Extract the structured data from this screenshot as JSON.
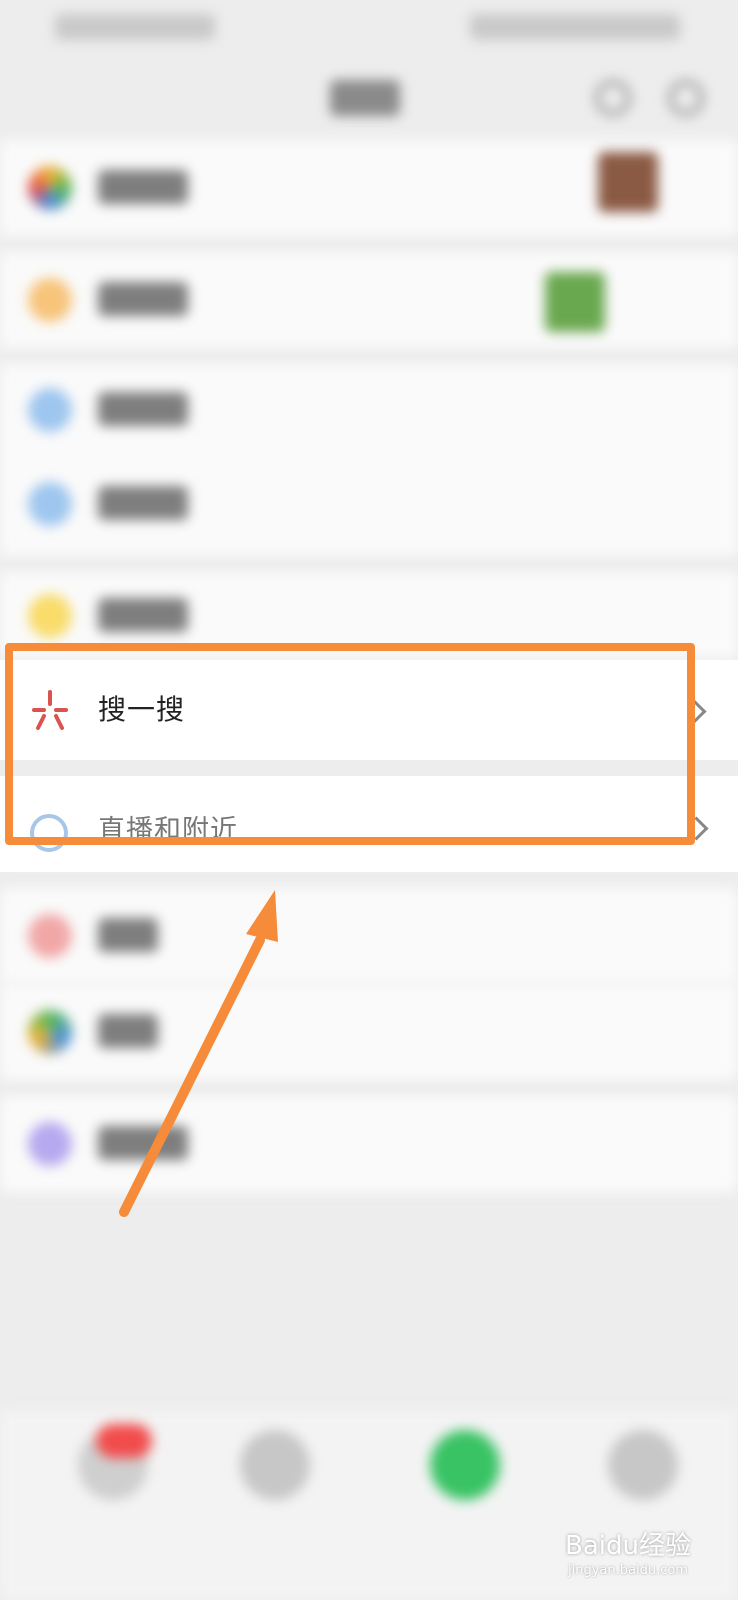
{
  "focus_rows": {
    "search": {
      "label": "搜一搜"
    },
    "live": {
      "label": "直播和附近"
    }
  },
  "watermark": {
    "brand": "Baidu经验",
    "site": "jingyan.baidu.com"
  },
  "colors": {
    "highlight": "#f68b3a",
    "search_icon": "#d9534f",
    "live_icon": "#a8c6e8"
  }
}
